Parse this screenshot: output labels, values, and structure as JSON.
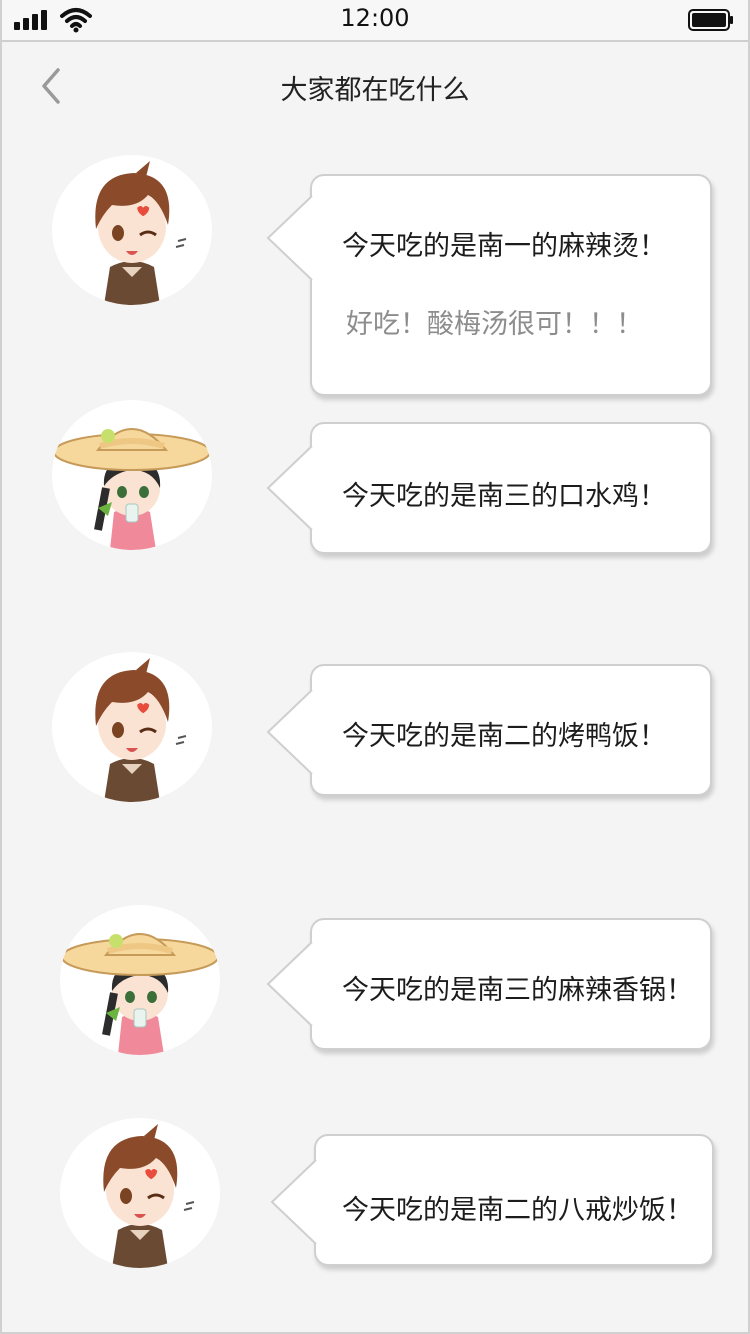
{
  "status_bar": {
    "time": "12:00"
  },
  "header": {
    "title": "大家都在吃什么"
  },
  "posts": [
    {
      "avatar": "boy-avatar",
      "message": "今天吃的是南一的麻辣烫！",
      "reply": "好吃！酸梅汤很可！！！"
    },
    {
      "avatar": "girl-sunhat-avatar",
      "message": "今天吃的是南三的口水鸡！"
    },
    {
      "avatar": "boy-avatar",
      "message": "今天吃的是南二的烤鸭饭！"
    },
    {
      "avatar": "girl-sunhat-avatar",
      "message": "今天吃的是南三的麻辣香锅！"
    },
    {
      "avatar": "boy-avatar",
      "message": "今天吃的是南二的八戒炒饭！"
    }
  ],
  "colors": {
    "background": "#f4f4f4",
    "bubble": "#ffffff",
    "bubble_border": "#cfcfcf",
    "reply_text": "#8d8d8d"
  }
}
